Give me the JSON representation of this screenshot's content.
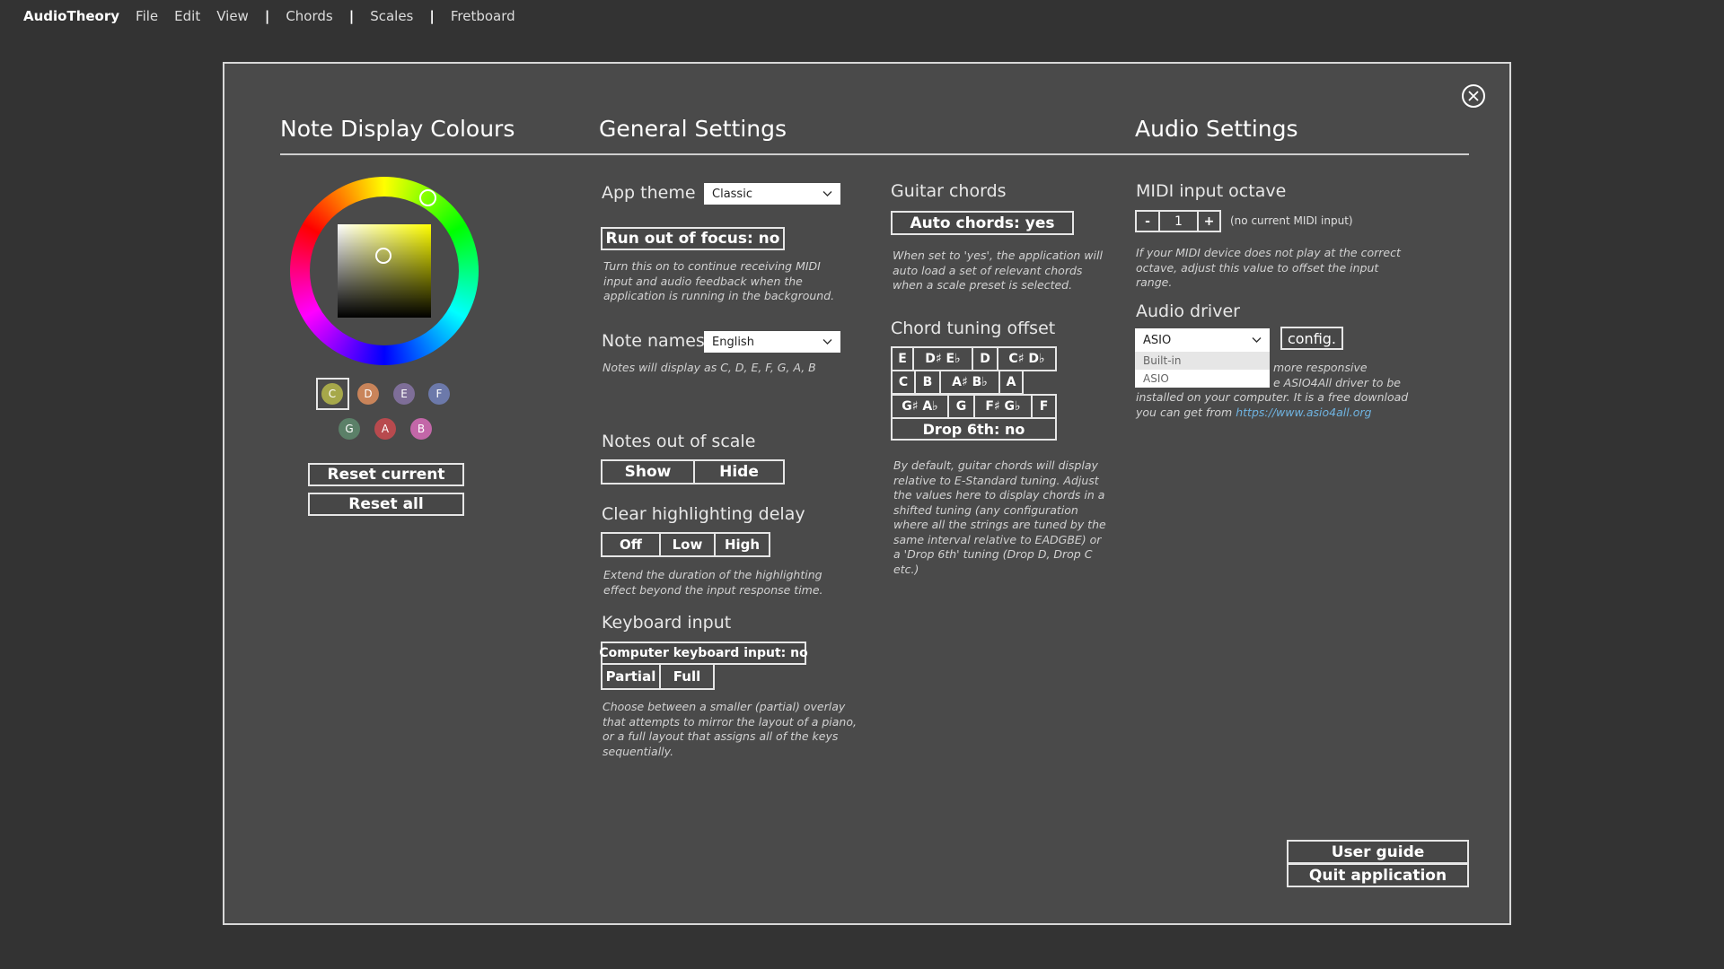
{
  "menu": {
    "brand": "AudioTheory",
    "items": [
      "File",
      "Edit",
      "View"
    ],
    "sections": [
      "Chords",
      "Scales",
      "Fretboard"
    ],
    "separator": "|"
  },
  "columns": {
    "colours": "Note Display Colours",
    "general": "General Settings",
    "audio": "Audio Settings"
  },
  "colours": {
    "swatches": [
      {
        "note": "C",
        "color": "#a6a84a"
      },
      {
        "note": "D",
        "color": "#c9845a"
      },
      {
        "note": "E",
        "color": "#7e6e98"
      },
      {
        "note": "F",
        "color": "#6c79aa"
      },
      {
        "note": "G",
        "color": "#5b8068"
      },
      {
        "note": "A",
        "color": "#b84a4e"
      },
      {
        "note": "B",
        "color": "#c367a8"
      }
    ],
    "reset_current": "Reset current",
    "reset_all": "Reset all"
  },
  "general": {
    "app_theme_label": "App theme",
    "app_theme_value": "Classic",
    "run_out_of_focus": "Run out of focus: no",
    "run_out_of_focus_desc": "Turn this on to continue receiving MIDI input and audio feedback when the application is running in the background.",
    "note_names_label": "Note names",
    "note_names_value": "English",
    "note_names_desc": "Notes will display as C, D, E, F, G, A, B",
    "notes_out_label": "Notes out of scale",
    "notes_out_options": [
      "Show",
      "Hide"
    ],
    "clear_delay_label": "Clear highlighting delay",
    "clear_delay_options": [
      "Off",
      "Low",
      "High"
    ],
    "clear_delay_desc": "Extend the duration of the highlighting effect beyond the input response time.",
    "keyboard_label": "Keyboard input",
    "keyboard_toggle": "Computer keyboard input: no",
    "keyboard_options": [
      "Partial",
      "Full"
    ],
    "keyboard_desc": "Choose between a smaller (partial) overlay that attempts to mirror the layout of a piano, or a full layout that assigns all of the keys sequentially."
  },
  "chords": {
    "guitar_label": "Guitar chords",
    "auto_chords": "Auto chords: yes",
    "auto_desc": "When set to 'yes', the application will auto load a set of relevant chords when a scale preset is selected.",
    "tuning_label": "Chord tuning offset",
    "row1": [
      "E",
      "D♯ E♭",
      "D",
      "C♯ D♭"
    ],
    "row2": [
      "C",
      "B",
      "A♯ B♭",
      "A"
    ],
    "row3": [
      "G♯ A♭",
      "G",
      "F♯ G♭",
      "F"
    ],
    "drop6": "Drop 6th: no",
    "tuning_desc": "By default, guitar chords will display relative to E-Standard tuning. Adjust the values here to display chords in a shifted tuning (any configuration where all the strings are tuned by the same interval relative to EADGBE) or a 'Drop 6th' tuning (Drop D, Drop C etc.)"
  },
  "audio": {
    "midi_octave_label": "MIDI input octave",
    "minus": "-",
    "octave_value": "1",
    "plus": "+",
    "midi_status": "(no current MIDI input)",
    "midi_desc": "If your MIDI device does not play at the correct octave, adjust this value to offset the input range.",
    "driver_label": "Audio driver",
    "driver_value": "ASIO",
    "config": "config.",
    "driver_options": [
      "Built-in",
      "ASIO"
    ],
    "driver_desc_line1": "more responsive",
    "driver_desc_line2": "e ASIO4All driver to be",
    "driver_desc_line3": "installed on your computer. It is a free download",
    "driver_desc_line4_prefix": "you can get from ",
    "driver_link": "https://www.asio4all.org"
  },
  "footer": {
    "user_guide": "User guide",
    "quit": "Quit application"
  }
}
